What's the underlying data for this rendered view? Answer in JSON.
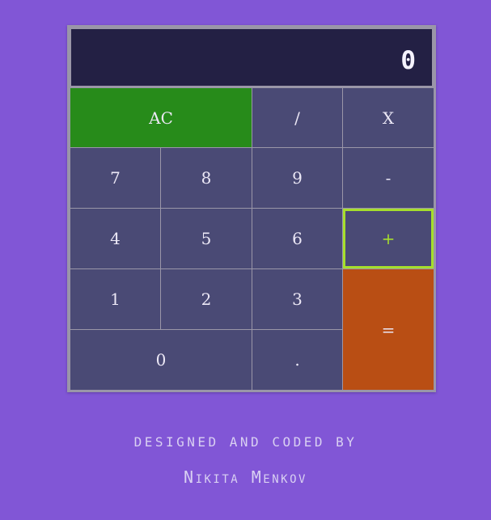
{
  "calculator": {
    "display": "0",
    "keys": {
      "ac": "AC",
      "divide": "/",
      "multiply": "X",
      "seven": "7",
      "eight": "8",
      "nine": "9",
      "minus": "-",
      "four": "4",
      "five": "5",
      "six": "6",
      "plus": "+",
      "one": "1",
      "two": "2",
      "three": "3",
      "equals": "=",
      "zero": "0",
      "decimal": "."
    },
    "colors": {
      "background": "#8156d6",
      "display": "#232044",
      "key": "#4a4a75",
      "clear": "#278b1a",
      "equals": "#b94e14",
      "focused_outline": "#a6de2c"
    }
  },
  "credits": {
    "line1": "Designed and coded by",
    "line2": "Nikita Menkov"
  }
}
